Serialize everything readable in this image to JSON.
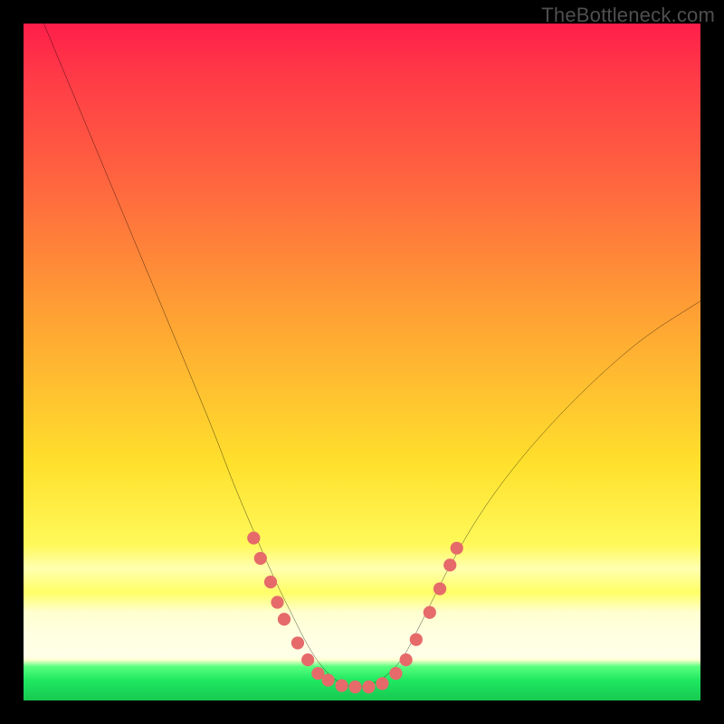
{
  "attribution": "TheBottleneck.com",
  "chart_data": {
    "type": "line",
    "title": "",
    "xlabel": "",
    "ylabel": "",
    "xlim": [
      0,
      100
    ],
    "ylim": [
      0,
      100
    ],
    "grid": false,
    "legend": false,
    "series": [
      {
        "name": "bottleneck-curve",
        "color": "#000000",
        "x": [
          3,
          8,
          13,
          18,
          23,
          28,
          31,
          34,
          37,
          40,
          42,
          44,
          46,
          48,
          50,
          53,
          56,
          58,
          60,
          63,
          67,
          72,
          78,
          85,
          92,
          100
        ],
        "y": [
          100,
          88,
          76,
          64,
          52,
          40,
          32,
          25,
          18,
          12,
          8,
          5,
          3,
          2,
          2,
          3,
          6,
          10,
          14,
          20,
          27,
          34,
          41,
          48,
          54,
          59
        ]
      }
    ],
    "markers": [
      {
        "name": "highlight-dots",
        "color": "#e66a6a",
        "points": [
          [
            34,
            24
          ],
          [
            35,
            21
          ],
          [
            36.5,
            17.5
          ],
          [
            37.5,
            14.5
          ],
          [
            38.5,
            12
          ],
          [
            40.5,
            8.5
          ],
          [
            42,
            6
          ],
          [
            43.5,
            4
          ],
          [
            45,
            3
          ],
          [
            47,
            2.2
          ],
          [
            49,
            2
          ],
          [
            51,
            2
          ],
          [
            53,
            2.5
          ],
          [
            55,
            4
          ],
          [
            56.5,
            6
          ],
          [
            58,
            9
          ],
          [
            60,
            13
          ],
          [
            61.5,
            16.5
          ],
          [
            63,
            20
          ],
          [
            64,
            22.5
          ]
        ]
      }
    ],
    "annotations": []
  }
}
